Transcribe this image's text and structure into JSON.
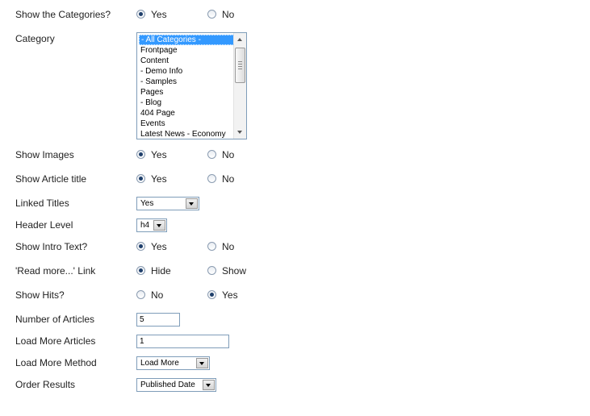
{
  "show_categories": {
    "label": "Show the Categories?",
    "yes": "Yes",
    "no": "No",
    "selected": "yes"
  },
  "category": {
    "label": "Category",
    "options": [
      "- All Categories -",
      "Frontpage",
      "Content",
      "- Demo Info",
      "- Samples",
      "Pages",
      "- Blog",
      "404 Page",
      "Events",
      "Latest News - Economy"
    ],
    "selected": "- All Categories -"
  },
  "show_images": {
    "label": "Show Images",
    "yes": "Yes",
    "no": "No",
    "selected": "yes"
  },
  "show_article_title": {
    "label": "Show Article title",
    "yes": "Yes",
    "no": "No",
    "selected": "yes"
  },
  "linked_titles": {
    "label": "Linked Titles",
    "value": "Yes"
  },
  "header_level": {
    "label": "Header Level",
    "value": "h4"
  },
  "show_intro_text": {
    "label": "Show Intro Text?",
    "yes": "Yes",
    "no": "No",
    "selected": "yes"
  },
  "read_more_link": {
    "label": "'Read more...' Link",
    "hide": "Hide",
    "show": "Show",
    "selected": "hide"
  },
  "show_hits": {
    "label": "Show Hits?",
    "no": "No",
    "yes": "Yes",
    "selected": "yes"
  },
  "number_of_articles": {
    "label": "Number of Articles",
    "value": "5"
  },
  "load_more_articles": {
    "label": "Load More Articles",
    "value": "1"
  },
  "load_more_method": {
    "label": "Load More Method",
    "value": "Load More"
  },
  "order_results": {
    "label": "Order Results",
    "value": "Published Date"
  }
}
